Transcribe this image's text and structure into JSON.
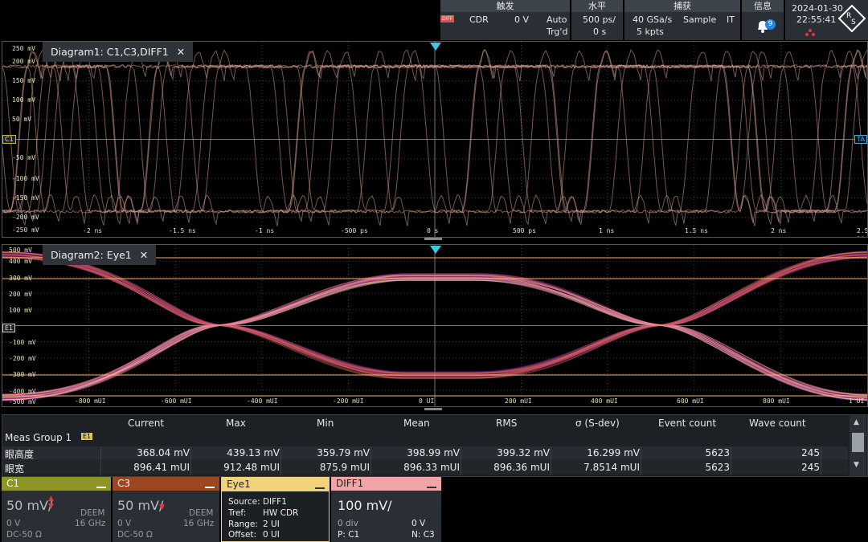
{
  "topbar": {
    "trigger": {
      "header": "触发",
      "source_badge": "DIFF",
      "type": "CDR",
      "level": "0 V",
      "mode": "Auto",
      "status": "Trg'd"
    },
    "horizontal": {
      "header": "水平",
      "scale": "500 ps/",
      "position": "0 s"
    },
    "acquisition": {
      "header": "捕获",
      "rate": "40 GSa/s",
      "points": "5 kpts",
      "mode": "Sample",
      "it": "IT"
    },
    "info": {
      "header": "信息",
      "count": "9"
    },
    "datetime": {
      "date": "2024-01-30",
      "time": "22:55:41"
    }
  },
  "diagram1": {
    "title": "Diagram1: C1,C3,DIFF1",
    "close": "✕",
    "y_labels": [
      "250 mV",
      "200 mV",
      "150 mV",
      "100 mV",
      "50 mV",
      "-50 mV",
      "-100 mV",
      "-150 mV",
      "-200 mV",
      "-250 mV"
    ],
    "x_labels": [
      "-2 ns",
      "-1.5 ns",
      "-1 ns",
      "-500 ps",
      "0 s",
      "500 ps",
      "1 ns",
      "1.5 ns",
      "2 ns",
      "2.5 ns"
    ],
    "c1_marker": "C1",
    "ta_marker": "TA"
  },
  "diagram2": {
    "title": "Diagram2: Eye1",
    "close": "✕",
    "y_labels": [
      "500 mV",
      "400 mV",
      "300 mV",
      "200 mV",
      "100 mV",
      "-100 mV",
      "-200 mV",
      "-300 mV",
      "-400 mV",
      "-500 mV"
    ],
    "x_labels": [
      "-800 mUI",
      "-600 mUI",
      "-400 mUI",
      "-200 mUI",
      "0 UI",
      "200 mUI",
      "400 mUI",
      "600 mUI",
      "800 mUI",
      "1 UI"
    ],
    "e1_marker": "E1"
  },
  "meas": {
    "group": "Meas Group 1",
    "group_badge": "E1",
    "columns": [
      "Current",
      "Max",
      "Min",
      "Mean",
      "RMS",
      "σ (S-dev)",
      "Event count",
      "Wave count"
    ],
    "rows": [
      {
        "name": "眼高度",
        "values": [
          "368.04 mV",
          "439.13 mV",
          "359.79 mV",
          "398.99 mV",
          "399.32 mV",
          "16.299 mV",
          "5623",
          "245"
        ]
      },
      {
        "name": "眼宽",
        "values": [
          "896.41 mUI",
          "912.48 mUI",
          "875.9 mUI",
          "896.33 mUI",
          "896.36 mUI",
          "7.8514 mUI",
          "5623",
          "245"
        ]
      }
    ]
  },
  "channels": {
    "c1": {
      "name": "C1",
      "scale": "50 mV/",
      "offset": "0 V",
      "deem": "DEEM",
      "bw": "16 GHz",
      "coupling": "DC-50 Ω",
      "color": "#9aa32a"
    },
    "c3": {
      "name": "C3",
      "scale": "50 mV/",
      "offset": "0 V",
      "deem": "DEEM",
      "bw": "16 GHz",
      "coupling": "DC-50 Ω",
      "color": "#b5572a"
    },
    "eye1": {
      "name": "Eye1",
      "source": "Source: DIFF1",
      "tref": "Tref:",
      "tref_val": "HW CDR",
      "range": "Range:",
      "range_val": "2 UI",
      "offset": "Offset:",
      "offset_val": "0 UI",
      "color": "#f2d27a"
    },
    "diff1": {
      "name": "DIFF1",
      "scale": "100 mV/",
      "div": "0 div",
      "volts": "0 V",
      "p": "P: C1",
      "n": "N: C3",
      "color": "#f0a6a6"
    }
  }
}
